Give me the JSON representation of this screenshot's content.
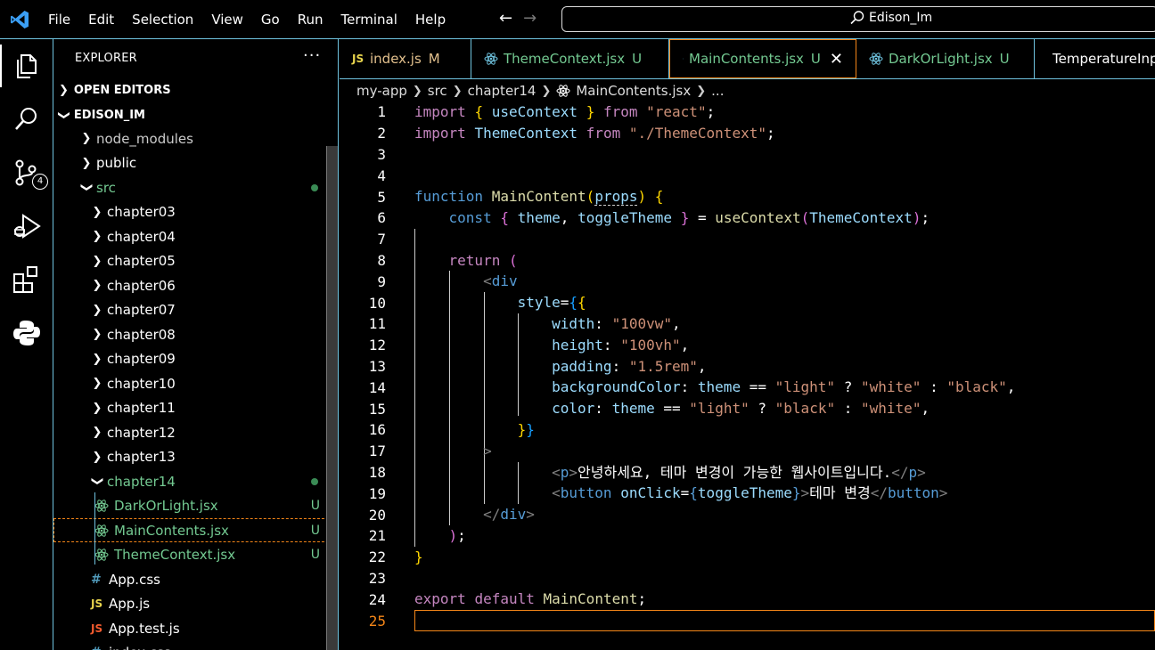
{
  "menu": [
    "File",
    "Edit",
    "Selection",
    "View",
    "Go",
    "Run",
    "Terminal",
    "Help"
  ],
  "search": {
    "text": "Edison_Im"
  },
  "activity": {
    "scm_badge": "4"
  },
  "sidebar": {
    "header": "EXPLORER",
    "more": "···",
    "open_editors": "OPEN EDITORS",
    "root": "EDISON_IM",
    "tree": [
      {
        "label": "node_modules",
        "type": "folder",
        "depth": 1,
        "expanded": false,
        "color": "grey"
      },
      {
        "label": "public",
        "type": "folder",
        "depth": 1,
        "expanded": false,
        "color": "white"
      },
      {
        "label": "src",
        "type": "folder",
        "depth": 1,
        "expanded": true,
        "color": "green",
        "dot": true
      },
      {
        "label": "chapter03",
        "type": "folder",
        "depth": 2,
        "expanded": false
      },
      {
        "label": "chapter04",
        "type": "folder",
        "depth": 2,
        "expanded": false
      },
      {
        "label": "chapter05",
        "type": "folder",
        "depth": 2,
        "expanded": false
      },
      {
        "label": "chapter06",
        "type": "folder",
        "depth": 2,
        "expanded": false
      },
      {
        "label": "chapter07",
        "type": "folder",
        "depth": 2,
        "expanded": false
      },
      {
        "label": "chapter08",
        "type": "folder",
        "depth": 2,
        "expanded": false
      },
      {
        "label": "chapter09",
        "type": "folder",
        "depth": 2,
        "expanded": false
      },
      {
        "label": "chapter10",
        "type": "folder",
        "depth": 2,
        "expanded": false
      },
      {
        "label": "chapter11",
        "type": "folder",
        "depth": 2,
        "expanded": false
      },
      {
        "label": "chapter12",
        "type": "folder",
        "depth": 2,
        "expanded": false
      },
      {
        "label": "chapter13",
        "type": "folder",
        "depth": 2,
        "expanded": false
      },
      {
        "label": "chapter14",
        "type": "folder",
        "depth": 2,
        "expanded": true,
        "color": "green",
        "dot": true
      },
      {
        "label": "DarkOrLight.jsx",
        "type": "react",
        "depth": 3,
        "status": "U"
      },
      {
        "label": "MainContents.jsx",
        "type": "react",
        "depth": 3,
        "status": "U",
        "selected": true
      },
      {
        "label": "ThemeContext.jsx",
        "type": "react",
        "depth": 3,
        "status": "U"
      },
      {
        "label": "App.css",
        "type": "css",
        "depth": 2
      },
      {
        "label": "App.js",
        "type": "js",
        "depth": 2
      },
      {
        "label": "App.test.js",
        "type": "test",
        "depth": 2
      },
      {
        "label": "index.css",
        "type": "css",
        "depth": 2
      }
    ]
  },
  "tabs": [
    {
      "label": "index.js",
      "status": "M",
      "icon": "js"
    },
    {
      "label": "ThemeContext.jsx",
      "status": "U",
      "icon": "react"
    },
    {
      "label": "MainContents.jsx",
      "status": "U",
      "icon": "react",
      "active": true
    },
    {
      "label": "DarkOrLight.jsx",
      "status": "U",
      "icon": "react"
    },
    {
      "label": "TemperatureInput.jsx",
      "status": "",
      "icon": "react"
    }
  ],
  "breadcrumb": [
    "my-app",
    "src",
    "chapter14",
    "MainContents.jsx",
    "..."
  ],
  "code": {
    "line_numbers": [
      "1",
      "2",
      "3",
      "4",
      "5",
      "6",
      "7",
      "8",
      "9",
      "10",
      "11",
      "12",
      "13",
      "14",
      "15",
      "16",
      "17",
      "18",
      "19",
      "20",
      "21",
      "22",
      "23",
      "24",
      "25"
    ],
    "l1": [
      "import",
      "{",
      "useContext",
      "}",
      "from",
      "\"react\"",
      ";"
    ],
    "l2": [
      "import",
      "ThemeContext",
      "from",
      "\"./ThemeContext\"",
      ";"
    ],
    "l5": [
      "function",
      "MainContent",
      "(",
      "props",
      ")",
      "{"
    ],
    "l6": [
      "const",
      "{",
      "theme",
      ",",
      "toggleTheme",
      "}",
      "=",
      "useContext",
      "(",
      "ThemeContext",
      ")",
      ";"
    ],
    "l8": [
      "return",
      "("
    ],
    "l9": [
      "<",
      "div"
    ],
    "l10": [
      "style",
      "=",
      "{",
      "{"
    ],
    "l11": [
      "width",
      ":",
      "\"100vw\"",
      ","
    ],
    "l12": [
      "height",
      ":",
      "\"100vh\"",
      ","
    ],
    "l13": [
      "padding",
      ":",
      "\"1.5rem\"",
      ","
    ],
    "l14": [
      "backgroundColor",
      ":",
      "theme",
      "==",
      "\"light\"",
      "?",
      "\"white\"",
      ":",
      "\"black\"",
      ","
    ],
    "l15": [
      "color",
      ":",
      "theme",
      "==",
      "\"light\"",
      "?",
      "\"black\"",
      ":",
      "\"white\"",
      ","
    ],
    "l16": [
      "}",
      "}"
    ],
    "l17": [
      ">"
    ],
    "l18": [
      "<",
      "p",
      ">",
      "안녕하세요, 테마 변경이 가능한 웹사이트입니다.",
      "</",
      "p",
      ">"
    ],
    "l19": [
      "<",
      "button",
      "onClick",
      "=",
      "{",
      "toggleTheme",
      "}",
      ">",
      "테마 변경",
      "</",
      "button",
      ">"
    ],
    "l20": [
      "</",
      "div",
      ">"
    ],
    "l21": [
      ")",
      ";"
    ],
    "l22": [
      "}"
    ],
    "l24": [
      "export",
      "default",
      "MainContent",
      ";"
    ]
  }
}
